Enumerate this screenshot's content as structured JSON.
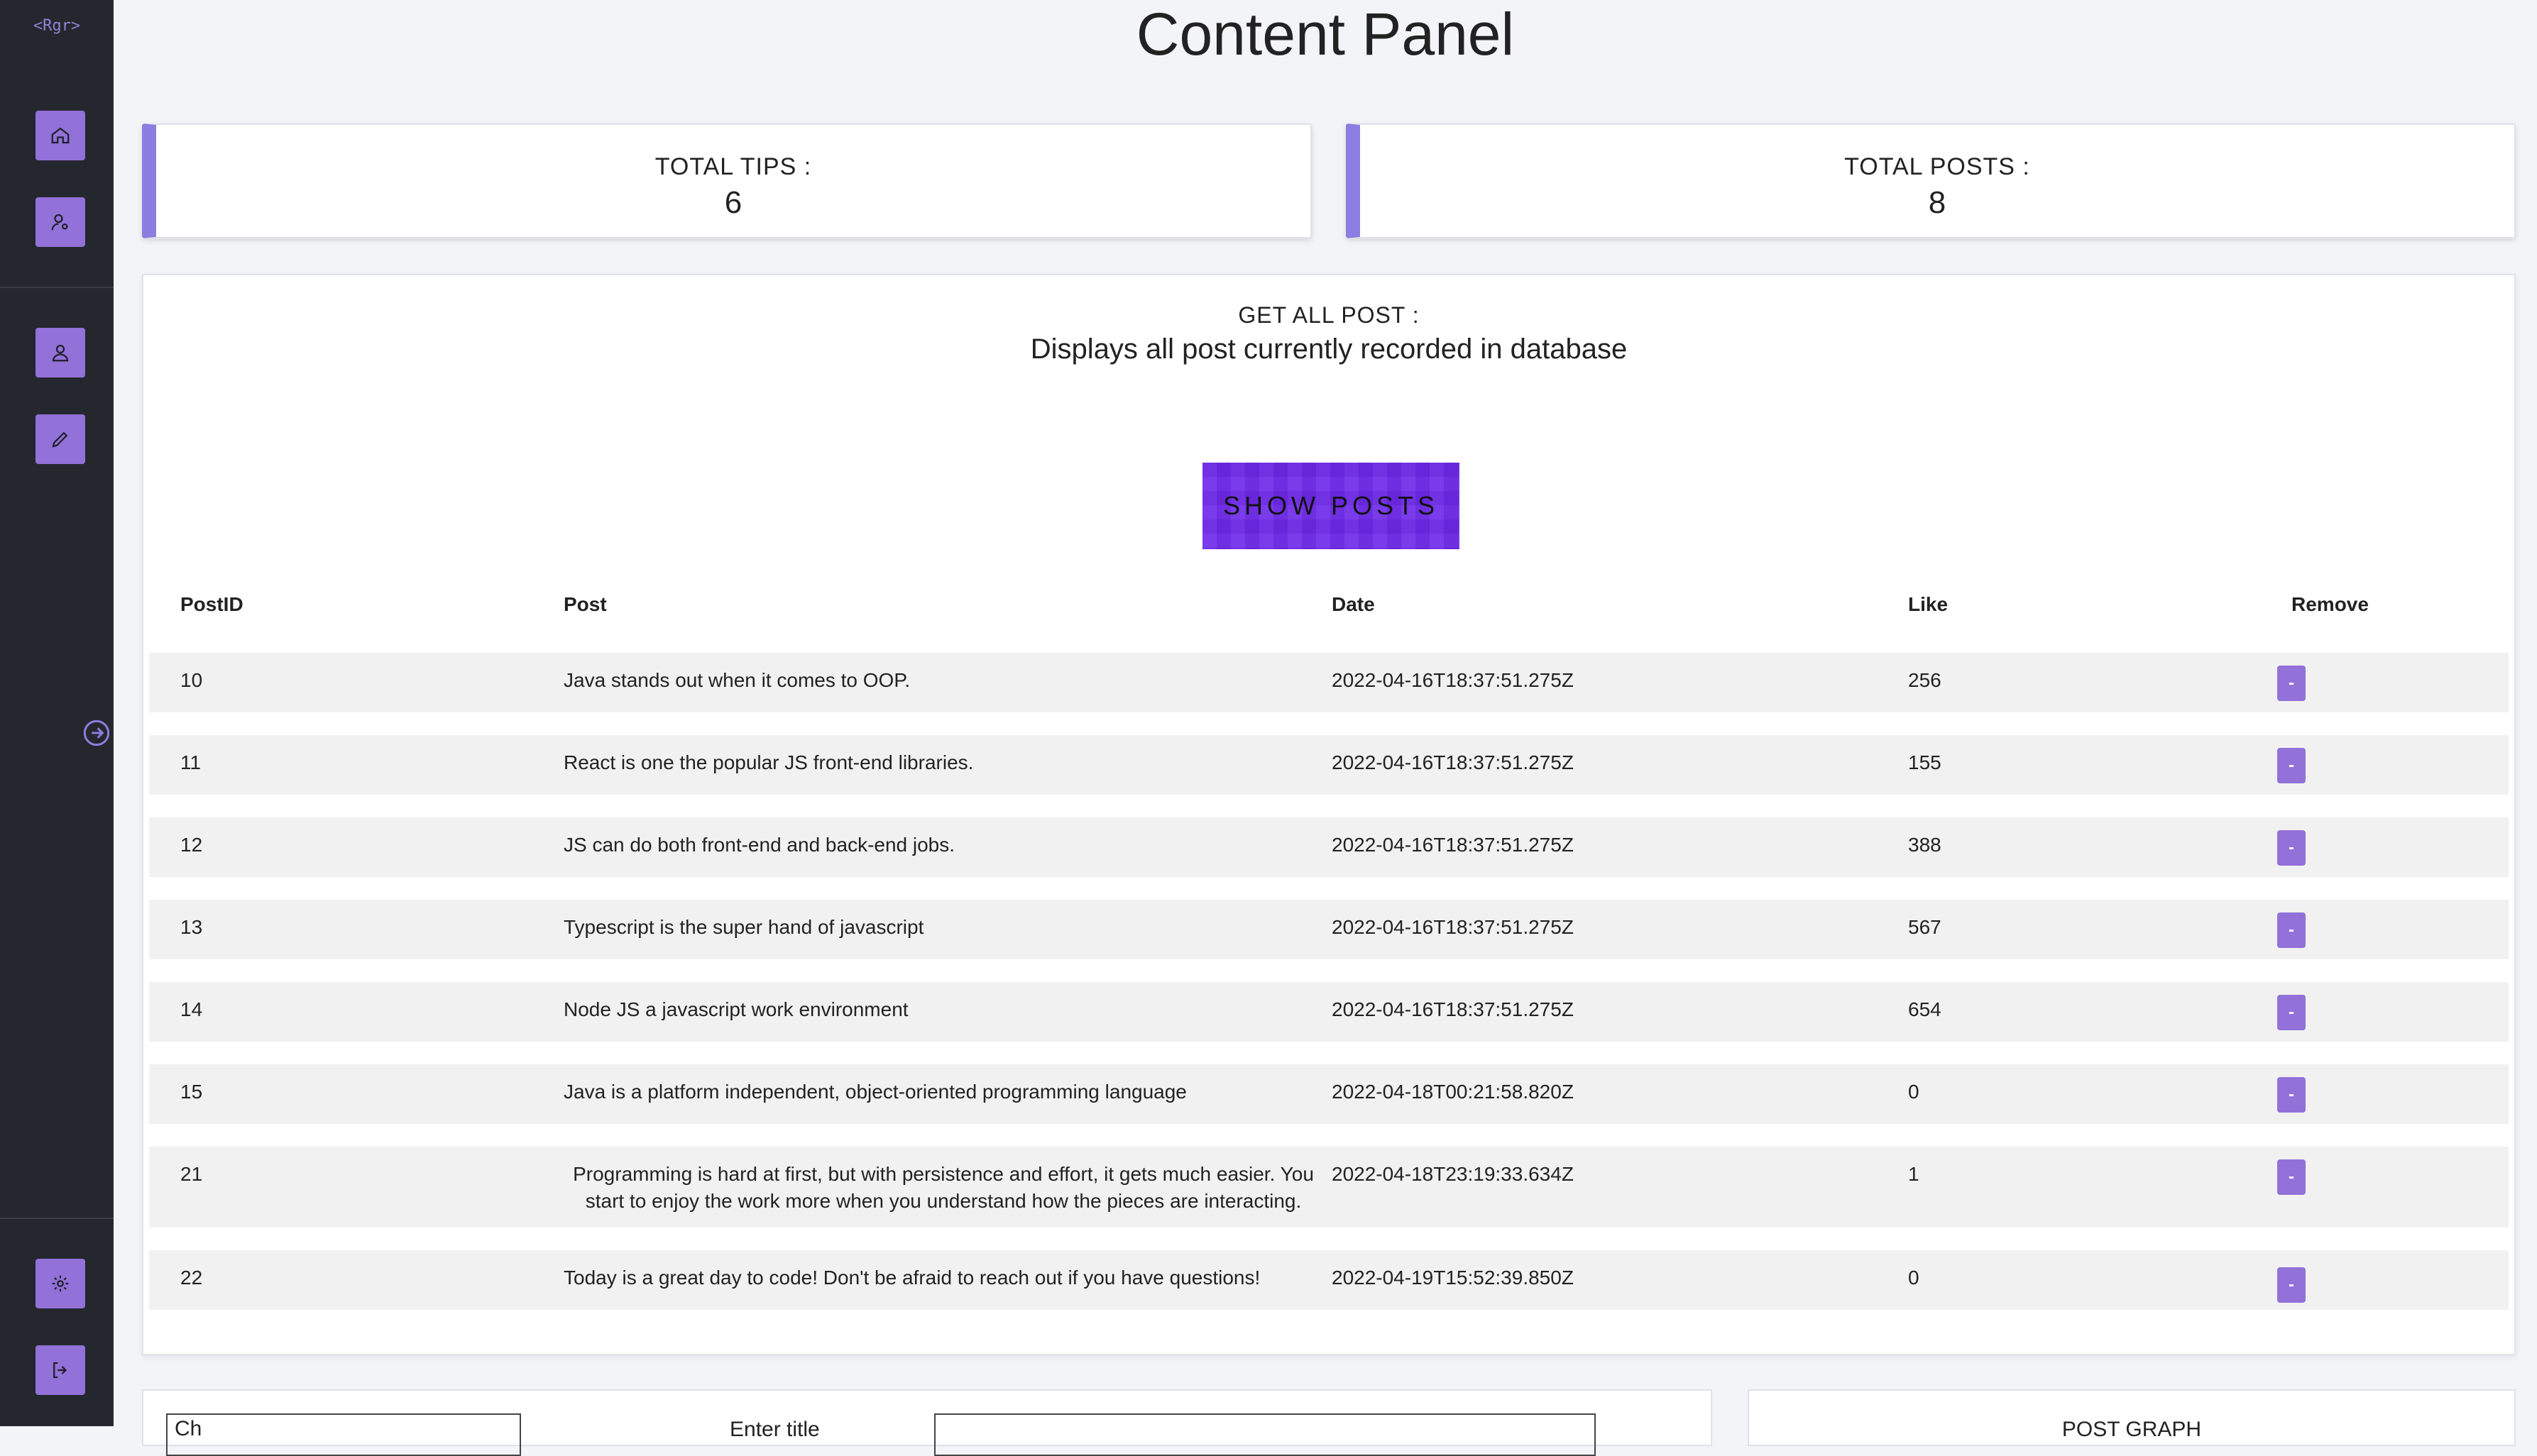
{
  "sidebar": {
    "logo": "<Rgr>",
    "buttons": [
      {
        "icon": "home-icon"
      },
      {
        "icon": "user-admin-icon"
      },
      {
        "icon": "user-icon"
      },
      {
        "icon": "pencil-icon"
      },
      {
        "icon": "gear-icon"
      },
      {
        "icon": "logout-icon"
      }
    ],
    "toggle_icon": "arrow-right-circle-icon"
  },
  "page": {
    "title": "Content Panel"
  },
  "stats": [
    {
      "label": "TOTAL TIPS :",
      "value": "6"
    },
    {
      "label": "TOTAL POSTS :",
      "value": "8"
    }
  ],
  "posts_panel": {
    "heading": "GET ALL POST :",
    "subheading": "Displays all post currently recorded in database",
    "show_button": "SHOW POSTS",
    "columns": [
      "PostID",
      "Post",
      "Date",
      "Like",
      "Remove"
    ],
    "remove_label": "-",
    "rows": [
      {
        "id": "10",
        "post": "Java stands out when it comes to OOP.",
        "date": "2022-04-16T18:37:51.275Z",
        "like": "256"
      },
      {
        "id": "11",
        "post": "React is one the popular JS front-end libraries.",
        "date": "2022-04-16T18:37:51.275Z",
        "like": "155"
      },
      {
        "id": "12",
        "post": "JS can do both front-end and back-end jobs.",
        "date": "2022-04-16T18:37:51.275Z",
        "like": "388"
      },
      {
        "id": "13",
        "post": "Typescript is the super hand of javascript",
        "date": "2022-04-16T18:37:51.275Z",
        "like": "567"
      },
      {
        "id": "14",
        "post": "Node JS a javascript work environment",
        "date": "2022-04-16T18:37:51.275Z",
        "like": "654"
      },
      {
        "id": "15",
        "post": "Java is a platform independent, object-oriented programming language",
        "date": "2022-04-18T00:21:58.820Z",
        "like": "0"
      },
      {
        "id": "21",
        "post": "Programming is hard at first, but with persistence and effort, it gets much easier. You start to enjoy the work more when you understand how the pieces are interacting.",
        "date": "2022-04-18T23:19:33.634Z",
        "like": "1"
      },
      {
        "id": "22",
        "post": "Today is a great day to code! Don't be afraid to reach out if you have questions!",
        "date": "2022-04-19T15:52:39.850Z",
        "like": "0"
      }
    ]
  },
  "bottom": {
    "select_value": "Ch",
    "title_label": "Enter title",
    "graph_title": "POST GRAPH"
  }
}
